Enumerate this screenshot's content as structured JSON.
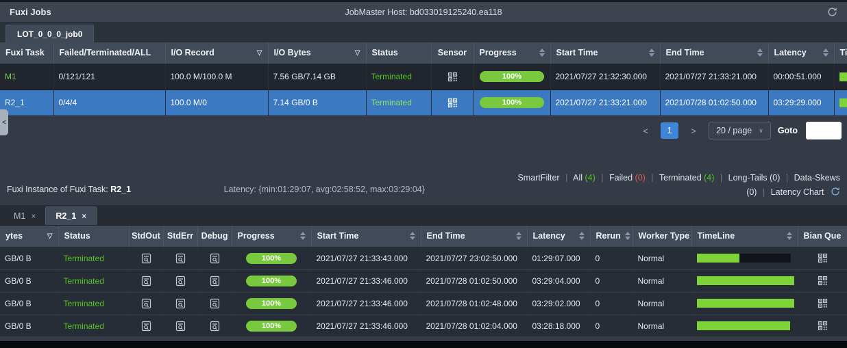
{
  "window": {
    "title": "Fuxi Jobs",
    "jobmaster_host": "JobMaster Host: bd033019125240.ea118"
  },
  "job_tab": {
    "label": "LOT_0_0_0_job0"
  },
  "icons": {
    "prev": "<",
    "next": ">",
    "filter": "▽",
    "close": "×",
    "select_chevron": "∨",
    "collapse": "<"
  },
  "tasks_table": {
    "headers": {
      "task": "Fuxi Task",
      "fta": "Failed/Terminated/ALL",
      "io_record": "I/O Record",
      "io_bytes": "I/O Bytes",
      "status": "Status",
      "sensor": "Sensor",
      "progress": "Progress",
      "start_time": "Start Time",
      "end_time": "End Time",
      "latency": "Latency",
      "timeline": "Tim"
    },
    "rows": [
      {
        "task": "M1",
        "fta": "0/121/121",
        "io_record": "100.0 M/100.0 M",
        "io_bytes": "7.56 GB/7.14 GB",
        "status": "Terminated",
        "progress": "100%",
        "start_time": "2021/07/27 21:32:30.000",
        "end_time": "2021/07/27 21:33:21.000",
        "latency": "00:00:51.000"
      },
      {
        "task": "R2_1",
        "fta": "0/4/4",
        "io_record": "100.0 M/0",
        "io_bytes": "7.14 GB/0 B",
        "status": "Terminated",
        "progress": "100%",
        "start_time": "2021/07/27 21:33:21.000",
        "end_time": "2021/07/28 01:02:50.000",
        "latency": "03:29:29.000"
      }
    ]
  },
  "pagination": {
    "current_page": "1",
    "page_size": "20 / page",
    "goto_label": "Goto",
    "goto_value": ""
  },
  "instance_section": {
    "title_prefix": "Fuxi Instance of Fuxi Task: ",
    "task_name": "R2_1",
    "latency_summary": "Latency: {min:01:29:07, avg:02:58:52, max:03:29:04}",
    "smartfilter": {
      "label": "SmartFilter",
      "sep": "|",
      "all_label": "All",
      "all_count": "(4)",
      "failed_label": "Failed",
      "failed_count": "(0)",
      "terminated_label": "Terminated",
      "terminated_count": "(4)",
      "longtails_label": "Long-Tails",
      "longtails_count": "(0)",
      "dataskews_label": "Data-Skews",
      "dataskews_count": "(0)",
      "latency_chart": "Latency Chart"
    }
  },
  "instance_tabs": [
    {
      "label": "M1"
    },
    {
      "label": "R2_1"
    }
  ],
  "instances_table": {
    "headers": {
      "bytes": "ytes",
      "status": "Status",
      "stdout": "StdOut",
      "stderr": "StdErr",
      "debug": "Debug",
      "progress": "Progress",
      "start_time": "Start Time",
      "end_time": "End Time",
      "latency": "Latency",
      "rerun": "Rerun",
      "worker_type": "Worker Type",
      "timeline": "TimeLine",
      "bianque": "Bian Que"
    },
    "rows": [
      {
        "bytes": "GB/0 B",
        "status": "Terminated",
        "progress": "100%",
        "start_time": "2021/07/27 21:33:43.000",
        "end_time": "2021/07/27 23:02:50.000",
        "latency": "01:29:07.000",
        "rerun": "0",
        "worker_type": "Normal",
        "tl_green": "width:44%",
        "tl_dark": "width:53%"
      },
      {
        "bytes": "GB/0 B",
        "status": "Terminated",
        "progress": "100%",
        "start_time": "2021/07/27 21:33:46.000",
        "end_time": "2021/07/28 01:02:50.000",
        "latency": "03:29:04.000",
        "rerun": "0",
        "worker_type": "Normal",
        "tl_green": "width:100%",
        "tl_dark": "width:0%"
      },
      {
        "bytes": "GB/0 B",
        "status": "Terminated",
        "progress": "100%",
        "start_time": "2021/07/27 21:33:46.000",
        "end_time": "2021/07/28 01:02:48.000",
        "latency": "03:29:02.000",
        "rerun": "0",
        "worker_type": "Normal",
        "tl_green": "width:100%",
        "tl_dark": "width:0%"
      },
      {
        "bytes": "GB/0 B",
        "status": "Terminated",
        "progress": "100%",
        "start_time": "2021/07/27 21:33:46.000",
        "end_time": "2021/07/28 01:02:04.000",
        "latency": "03:28:18.000",
        "rerun": "0",
        "worker_type": "Normal",
        "tl_green": "width:96%",
        "tl_dark": "width:0%"
      }
    ]
  },
  "colors": {
    "accent_blue": "#3f86d8",
    "selected_row_blue": "#3b79c1",
    "status_green": "#55c41e",
    "progress_green": "#78c93e",
    "timeline_green": "#7ed336",
    "timeline_dark": "#11151b",
    "failed_red": "#e25a4d"
  }
}
